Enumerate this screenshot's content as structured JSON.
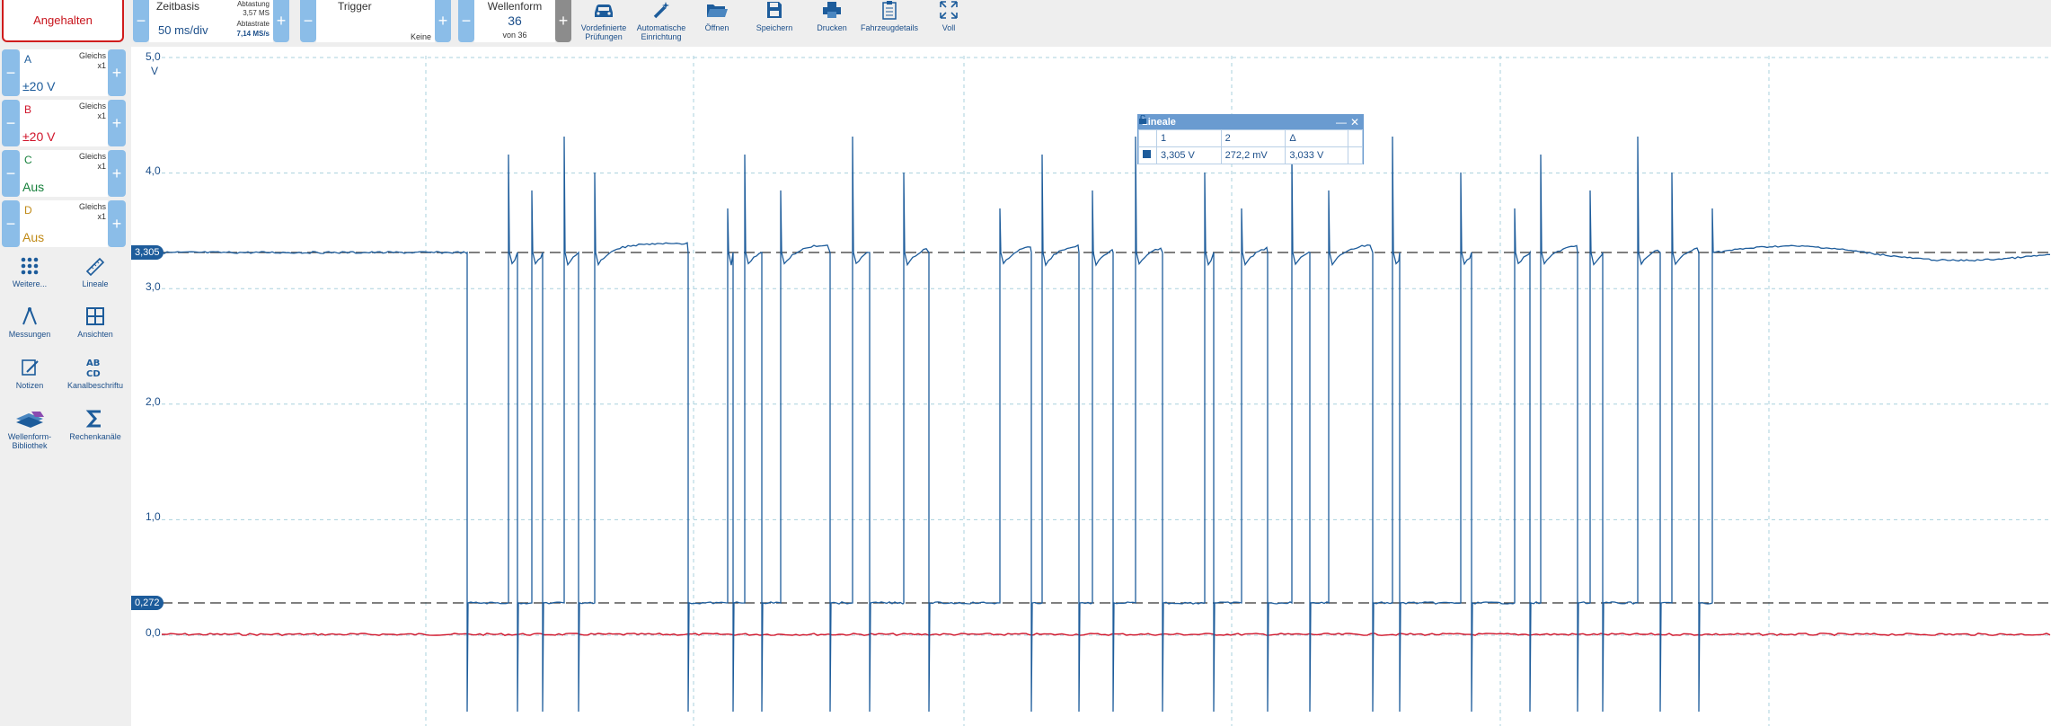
{
  "toolbar": {
    "run_button": "Angehalten",
    "timebase": {
      "title": "Zeitbasis",
      "value": "50 ms/div",
      "sample_label": "Abtastung",
      "samples": "3,57 MS",
      "rate_label": "Abtastrate",
      "rate": "7,14 MS/s"
    },
    "trigger": {
      "title": "Trigger",
      "mode": "Keine"
    },
    "waveform": {
      "title": "Wellenform",
      "value": "36",
      "of": "von 36"
    },
    "buttons": [
      {
        "label": "Vordefinierte Prüfungen",
        "icon": "car-icon"
      },
      {
        "label": "Automatische Einrichtung",
        "icon": "wand-icon"
      },
      {
        "label": "Öffnen",
        "icon": "folder-icon"
      },
      {
        "label": "Speichern",
        "icon": "save-icon"
      },
      {
        "label": "Drucken",
        "icon": "printer-icon"
      },
      {
        "label": "Fahrzeugdetails",
        "icon": "clipboard-icon"
      },
      {
        "label": "Voll",
        "icon": "fullscreen-icon"
      }
    ]
  },
  "channels": [
    {
      "letter": "A",
      "coupling": "Gleichs",
      "probe": "x1",
      "range": "±20 V",
      "color": "#1d5c9b"
    },
    {
      "letter": "B",
      "coupling": "Gleichs",
      "probe": "x1",
      "range": "±20 V",
      "color": "#d0142a"
    },
    {
      "letter": "C",
      "coupling": "Gleichs",
      "probe": "x1",
      "range": "Aus",
      "color": "#17803c"
    },
    {
      "letter": "D",
      "coupling": "Gleichs",
      "probe": "x1",
      "range": "Aus",
      "color": "#c08a17"
    }
  ],
  "tools": [
    {
      "label": "Weitere...",
      "icon": "dots-icon"
    },
    {
      "label": "Lineale",
      "icon": "ruler-icon"
    },
    {
      "label": "Messungen",
      "icon": "caliper-icon"
    },
    {
      "label": "Ansichten",
      "icon": "grid-icon"
    },
    {
      "label": "Notizen",
      "icon": "note-icon"
    },
    {
      "label": "Kanalbeschriftu",
      "icon": "abcd-icon"
    },
    {
      "label": "Wellenform-Bibliothek",
      "icon": "library-icon"
    },
    {
      "label": "Rechenkanäle",
      "icon": "sigma-icon"
    }
  ],
  "scope": {
    "y_unit": "V",
    "y_ticks": [
      "5,0",
      "4,0",
      "3,0",
      "2,0",
      "1,0",
      "0,0"
    ],
    "rulers": [
      "3,305",
      "0,272"
    ],
    "colors": {
      "channel_a": "#1d5c9b",
      "channel_b": "#d0142a",
      "grid": "#a9d1dd"
    }
  },
  "ruler_window": {
    "title": "Lineale",
    "col1": "1",
    "col2": "2",
    "col3": "Δ",
    "v1": "3,305 V",
    "v2": "272,2 mV",
    "delta": "3,033 V"
  }
}
